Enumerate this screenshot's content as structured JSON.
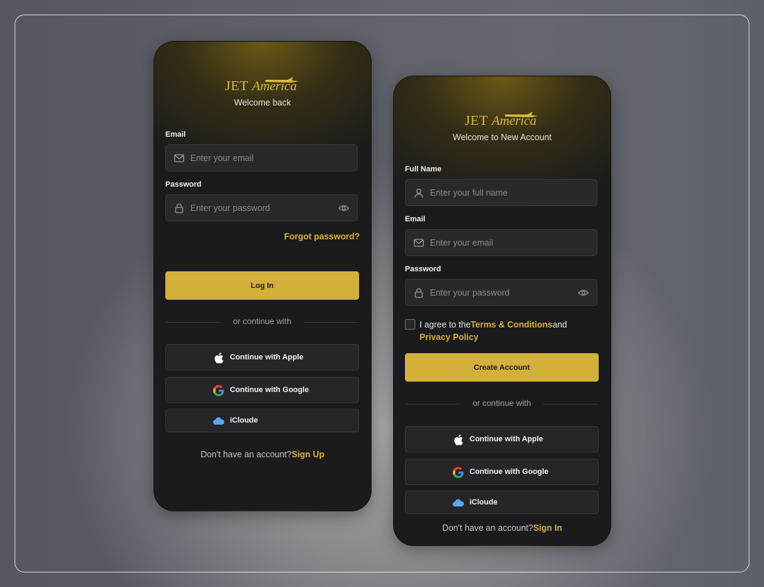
{
  "brand": {
    "logo_text_1": "JET",
    "logo_text_2": "America",
    "accent": "#d3b03c"
  },
  "login": {
    "subtitle": "Welcome back",
    "email_label": "Email",
    "email_placeholder": "Enter your email",
    "password_label": "Password",
    "password_placeholder": "Enter your password",
    "forgot": "Forgot password?",
    "login_button": "Log In",
    "divider": "or continue with",
    "apple": "Continue with Apple",
    "google": "Continue with Google",
    "icloud": "iCloude",
    "footer_text": "Don't have an account?",
    "footer_link": "Sign Up"
  },
  "signup": {
    "subtitle": "Welcome to New Account",
    "name_label": "Full Name",
    "name_placeholder": "Enter your full name",
    "email_label": "Email",
    "email_placeholder": "Enter your email",
    "password_label": "Password",
    "password_placeholder": "Enter your password",
    "agree_prefix": "I agree to the",
    "agree_terms": "Terms & Conditions",
    "agree_and": "and",
    "agree_privacy": "Privacy Policy",
    "create_button": "Create Account",
    "divider": "or continue with",
    "apple": "Continue with Apple",
    "google": "Continue with Google",
    "icloud": "iCloude",
    "footer_text": "Don't have an account?",
    "footer_link": "Sign In"
  }
}
